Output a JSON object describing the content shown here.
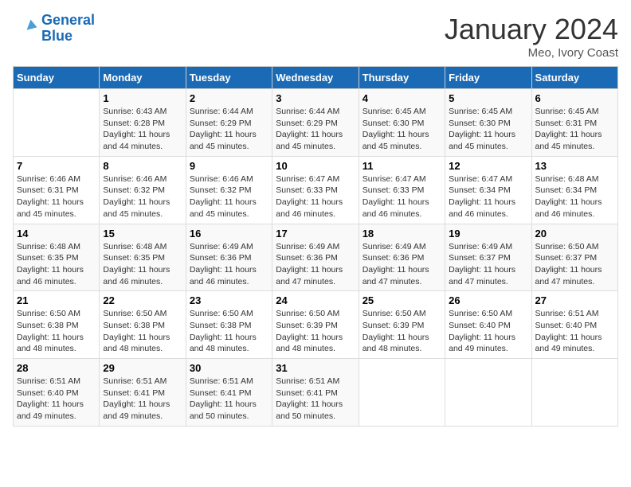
{
  "header": {
    "logo_line1": "General",
    "logo_line2": "Blue",
    "month": "January 2024",
    "location": "Meo, Ivory Coast"
  },
  "weekdays": [
    "Sunday",
    "Monday",
    "Tuesday",
    "Wednesday",
    "Thursday",
    "Friday",
    "Saturday"
  ],
  "weeks": [
    [
      {
        "day": "",
        "info": ""
      },
      {
        "day": "1",
        "info": "Sunrise: 6:43 AM\nSunset: 6:28 PM\nDaylight: 11 hours\nand 44 minutes."
      },
      {
        "day": "2",
        "info": "Sunrise: 6:44 AM\nSunset: 6:29 PM\nDaylight: 11 hours\nand 45 minutes."
      },
      {
        "day": "3",
        "info": "Sunrise: 6:44 AM\nSunset: 6:29 PM\nDaylight: 11 hours\nand 45 minutes."
      },
      {
        "day": "4",
        "info": "Sunrise: 6:45 AM\nSunset: 6:30 PM\nDaylight: 11 hours\nand 45 minutes."
      },
      {
        "day": "5",
        "info": "Sunrise: 6:45 AM\nSunset: 6:30 PM\nDaylight: 11 hours\nand 45 minutes."
      },
      {
        "day": "6",
        "info": "Sunrise: 6:45 AM\nSunset: 6:31 PM\nDaylight: 11 hours\nand 45 minutes."
      }
    ],
    [
      {
        "day": "7",
        "info": "Sunrise: 6:46 AM\nSunset: 6:31 PM\nDaylight: 11 hours\nand 45 minutes."
      },
      {
        "day": "8",
        "info": "Sunrise: 6:46 AM\nSunset: 6:32 PM\nDaylight: 11 hours\nand 45 minutes."
      },
      {
        "day": "9",
        "info": "Sunrise: 6:46 AM\nSunset: 6:32 PM\nDaylight: 11 hours\nand 45 minutes."
      },
      {
        "day": "10",
        "info": "Sunrise: 6:47 AM\nSunset: 6:33 PM\nDaylight: 11 hours\nand 46 minutes."
      },
      {
        "day": "11",
        "info": "Sunrise: 6:47 AM\nSunset: 6:33 PM\nDaylight: 11 hours\nand 46 minutes."
      },
      {
        "day": "12",
        "info": "Sunrise: 6:47 AM\nSunset: 6:34 PM\nDaylight: 11 hours\nand 46 minutes."
      },
      {
        "day": "13",
        "info": "Sunrise: 6:48 AM\nSunset: 6:34 PM\nDaylight: 11 hours\nand 46 minutes."
      }
    ],
    [
      {
        "day": "14",
        "info": "Sunrise: 6:48 AM\nSunset: 6:35 PM\nDaylight: 11 hours\nand 46 minutes."
      },
      {
        "day": "15",
        "info": "Sunrise: 6:48 AM\nSunset: 6:35 PM\nDaylight: 11 hours\nand 46 minutes."
      },
      {
        "day": "16",
        "info": "Sunrise: 6:49 AM\nSunset: 6:36 PM\nDaylight: 11 hours\nand 46 minutes."
      },
      {
        "day": "17",
        "info": "Sunrise: 6:49 AM\nSunset: 6:36 PM\nDaylight: 11 hours\nand 47 minutes."
      },
      {
        "day": "18",
        "info": "Sunrise: 6:49 AM\nSunset: 6:36 PM\nDaylight: 11 hours\nand 47 minutes."
      },
      {
        "day": "19",
        "info": "Sunrise: 6:49 AM\nSunset: 6:37 PM\nDaylight: 11 hours\nand 47 minutes."
      },
      {
        "day": "20",
        "info": "Sunrise: 6:50 AM\nSunset: 6:37 PM\nDaylight: 11 hours\nand 47 minutes."
      }
    ],
    [
      {
        "day": "21",
        "info": "Sunrise: 6:50 AM\nSunset: 6:38 PM\nDaylight: 11 hours\nand 48 minutes."
      },
      {
        "day": "22",
        "info": "Sunrise: 6:50 AM\nSunset: 6:38 PM\nDaylight: 11 hours\nand 48 minutes."
      },
      {
        "day": "23",
        "info": "Sunrise: 6:50 AM\nSunset: 6:38 PM\nDaylight: 11 hours\nand 48 minutes."
      },
      {
        "day": "24",
        "info": "Sunrise: 6:50 AM\nSunset: 6:39 PM\nDaylight: 11 hours\nand 48 minutes."
      },
      {
        "day": "25",
        "info": "Sunrise: 6:50 AM\nSunset: 6:39 PM\nDaylight: 11 hours\nand 48 minutes."
      },
      {
        "day": "26",
        "info": "Sunrise: 6:50 AM\nSunset: 6:40 PM\nDaylight: 11 hours\nand 49 minutes."
      },
      {
        "day": "27",
        "info": "Sunrise: 6:51 AM\nSunset: 6:40 PM\nDaylight: 11 hours\nand 49 minutes."
      }
    ],
    [
      {
        "day": "28",
        "info": "Sunrise: 6:51 AM\nSunset: 6:40 PM\nDaylight: 11 hours\nand 49 minutes."
      },
      {
        "day": "29",
        "info": "Sunrise: 6:51 AM\nSunset: 6:41 PM\nDaylight: 11 hours\nand 49 minutes."
      },
      {
        "day": "30",
        "info": "Sunrise: 6:51 AM\nSunset: 6:41 PM\nDaylight: 11 hours\nand 50 minutes."
      },
      {
        "day": "31",
        "info": "Sunrise: 6:51 AM\nSunset: 6:41 PM\nDaylight: 11 hours\nand 50 minutes."
      },
      {
        "day": "",
        "info": ""
      },
      {
        "day": "",
        "info": ""
      },
      {
        "day": "",
        "info": ""
      }
    ]
  ]
}
